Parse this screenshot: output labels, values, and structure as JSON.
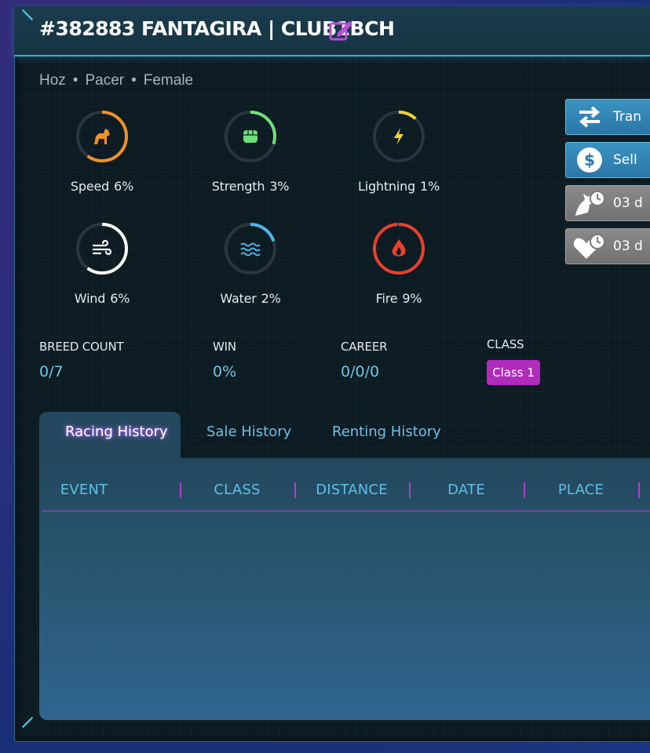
{
  "header": {
    "title": "#382883 FANTAGIRA | CLUB1BCH"
  },
  "profile": {
    "breed": "Hoz",
    "type": "Pacer",
    "gender": "Female"
  },
  "stats": [
    {
      "name": "Speed",
      "value": "6%",
      "fraction": 0.6,
      "color": "#f0902a",
      "icon": "horse-icon"
    },
    {
      "name": "Strength",
      "value": "3%",
      "fraction": 0.3,
      "color": "#6ee07a",
      "icon": "fist-icon"
    },
    {
      "name": "Lightning",
      "value": "1%",
      "fraction": 0.12,
      "color": "#f2d13a",
      "icon": "lightning-icon"
    },
    {
      "name": "Wind",
      "value": "6%",
      "fraction": 0.6,
      "color": "#ffffff",
      "icon": "wind-icon"
    },
    {
      "name": "Water",
      "value": "2%",
      "fraction": 0.2,
      "color": "#4fb6e8",
      "icon": "water-icon"
    },
    {
      "name": "Fire",
      "value": "9%",
      "fraction": 0.99,
      "color": "#e8402e",
      "icon": "fire-icon"
    }
  ],
  "info": {
    "breed_count_label": "BREED COUNT",
    "breed_count_value": "0/7",
    "win_label": "WIN",
    "win_value": "0%",
    "career_label": "CAREER",
    "career_value": "0/0/0",
    "class_label": "CLASS",
    "class_value": "Class 1"
  },
  "actions": [
    {
      "label": "Tran",
      "style": "blue",
      "icon": "transfer-arrows-icon"
    },
    {
      "label": "Sell",
      "style": "blue",
      "icon": "dollar-icon"
    },
    {
      "label": "03 d",
      "style": "grey",
      "icon": "horse-timer-icon"
    },
    {
      "label": "03 d",
      "style": "grey",
      "icon": "heart-timer-icon"
    }
  ],
  "tabs": [
    {
      "label": "Racing History",
      "active": true
    },
    {
      "label": "Sale History",
      "active": false
    },
    {
      "label": "Renting History",
      "active": false
    }
  ],
  "table": {
    "columns": [
      "EVENT",
      "CLASS",
      "DISTANCE",
      "DATE",
      "PLACE"
    ],
    "rows": []
  },
  "colors": {
    "accent": "#3fa8cf",
    "class_badge": "#b12bbd",
    "value_text": "#6fc7e8",
    "divider": "#b040c8"
  }
}
